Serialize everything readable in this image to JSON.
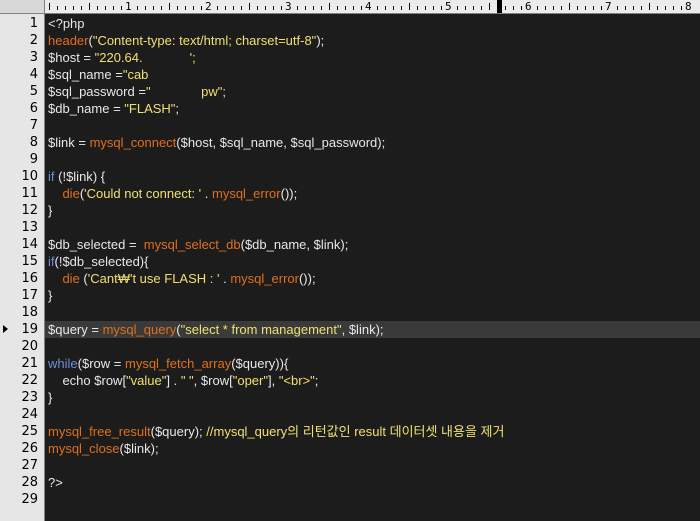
{
  "ruler": {
    "numbers": [
      "1",
      "2",
      "3",
      "4",
      "5",
      "6",
      "7",
      "8"
    ]
  },
  "current_line": 19,
  "lines": [
    [
      {
        "c": "tag",
        "t": "<?php"
      }
    ],
    [
      {
        "c": "fn",
        "t": "header"
      },
      {
        "c": "op",
        "t": "("
      },
      {
        "c": "str",
        "t": "\"Content-type: text/html; charset=utf-8\""
      },
      {
        "c": "op",
        "t": ");"
      }
    ],
    [
      {
        "c": "var",
        "t": "$host"
      },
      {
        "c": "op",
        "t": " = "
      },
      {
        "c": "str",
        "t": "\"220.64.             ';"
      }
    ],
    [
      {
        "c": "var",
        "t": "$sql_name"
      },
      {
        "c": "op",
        "t": " ="
      },
      {
        "c": "str",
        "t": "\"cab"
      }
    ],
    [
      {
        "c": "var",
        "t": "$sql_password"
      },
      {
        "c": "op",
        "t": " ="
      },
      {
        "c": "str",
        "t": "\"              pw\";"
      }
    ],
    [
      {
        "c": "var",
        "t": "$db_name"
      },
      {
        "c": "op",
        "t": " = "
      },
      {
        "c": "str",
        "t": "\"FLASH\""
      },
      {
        "c": "op",
        "t": ";"
      }
    ],
    [],
    [
      {
        "c": "var",
        "t": "$link"
      },
      {
        "c": "op",
        "t": " = "
      },
      {
        "c": "fn",
        "t": "mysql_connect"
      },
      {
        "c": "op",
        "t": "("
      },
      {
        "c": "var",
        "t": "$host"
      },
      {
        "c": "op",
        "t": ", "
      },
      {
        "c": "var",
        "t": "$sql_name"
      },
      {
        "c": "op",
        "t": ", "
      },
      {
        "c": "var",
        "t": "$sql_password"
      },
      {
        "c": "op",
        "t": ");"
      }
    ],
    [],
    [
      {
        "c": "kw",
        "t": "if"
      },
      {
        "c": "op",
        "t": " (!"
      },
      {
        "c": "var",
        "t": "$link"
      },
      {
        "c": "op",
        "t": ") {"
      }
    ],
    [
      {
        "c": "op",
        "t": "    "
      },
      {
        "c": "fn",
        "t": "die"
      },
      {
        "c": "op",
        "t": "("
      },
      {
        "c": "str",
        "t": "'Could not connect: '"
      },
      {
        "c": "op",
        "t": " . "
      },
      {
        "c": "fn",
        "t": "mysql_error"
      },
      {
        "c": "op",
        "t": "());"
      }
    ],
    [
      {
        "c": "op",
        "t": "}"
      }
    ],
    [],
    [
      {
        "c": "var",
        "t": "$db_selected"
      },
      {
        "c": "op",
        "t": " =  "
      },
      {
        "c": "fn",
        "t": "mysql_select_db"
      },
      {
        "c": "op",
        "t": "("
      },
      {
        "c": "var",
        "t": "$db_name"
      },
      {
        "c": "op",
        "t": ", "
      },
      {
        "c": "var",
        "t": "$link"
      },
      {
        "c": "op",
        "t": ");"
      }
    ],
    [
      {
        "c": "kw",
        "t": "if"
      },
      {
        "c": "op",
        "t": "(!"
      },
      {
        "c": "var",
        "t": "$db_selected"
      },
      {
        "c": "op",
        "t": "){"
      }
    ],
    [
      {
        "c": "op",
        "t": "    "
      },
      {
        "c": "fn",
        "t": "die"
      },
      {
        "c": "op",
        "t": " ("
      },
      {
        "c": "str",
        "t": "'Cant₩'t use FLASH : '"
      },
      {
        "c": "op",
        "t": " . "
      },
      {
        "c": "fn",
        "t": "mysql_error"
      },
      {
        "c": "op",
        "t": "());"
      }
    ],
    [
      {
        "c": "op",
        "t": "}"
      }
    ],
    [],
    [
      {
        "c": "var",
        "t": "$query"
      },
      {
        "c": "op",
        "t": " = "
      },
      {
        "c": "fn",
        "t": "mysql_query"
      },
      {
        "c": "op",
        "t": "("
      },
      {
        "c": "str",
        "t": "\"select * from management\""
      },
      {
        "c": "op",
        "t": ", "
      },
      {
        "c": "var",
        "t": "$link"
      },
      {
        "c": "op",
        "t": ");"
      }
    ],
    [],
    [
      {
        "c": "kw",
        "t": "while"
      },
      {
        "c": "op",
        "t": "("
      },
      {
        "c": "var",
        "t": "$row"
      },
      {
        "c": "op",
        "t": " = "
      },
      {
        "c": "fn",
        "t": "mysql_fetch_array"
      },
      {
        "c": "op",
        "t": "("
      },
      {
        "c": "var",
        "t": "$query"
      },
      {
        "c": "op",
        "t": ")){"
      }
    ],
    [
      {
        "c": "op",
        "t": "    "
      },
      {
        "c": "var",
        "t": "echo $row"
      },
      {
        "c": "op",
        "t": "["
      },
      {
        "c": "str",
        "t": "\"value\""
      },
      {
        "c": "op",
        "t": "] . "
      },
      {
        "c": "str",
        "t": "\" \""
      },
      {
        "c": "op",
        "t": ", "
      },
      {
        "c": "var",
        "t": "$row"
      },
      {
        "c": "op",
        "t": "["
      },
      {
        "c": "str",
        "t": "\"oper\""
      },
      {
        "c": "op",
        "t": "], "
      },
      {
        "c": "str",
        "t": "\"<br>\""
      },
      {
        "c": "op",
        "t": ";"
      }
    ],
    [
      {
        "c": "op",
        "t": "}"
      }
    ],
    [],
    [
      {
        "c": "fn",
        "t": "mysql_free_result"
      },
      {
        "c": "op",
        "t": "("
      },
      {
        "c": "var",
        "t": "$query"
      },
      {
        "c": "op",
        "t": "); "
      },
      {
        "c": "cm",
        "t": "//mysql_query의 리턴값인 result 데이터셋 내용을 제거"
      }
    ],
    [
      {
        "c": "fn",
        "t": "mysql_close"
      },
      {
        "c": "op",
        "t": "("
      },
      {
        "c": "var",
        "t": "$link"
      },
      {
        "c": "op",
        "t": ");"
      }
    ],
    [],
    [
      {
        "c": "tag",
        "t": "?>"
      }
    ],
    []
  ],
  "colors": {
    "background": "#1c1c1c",
    "keyword": "#6c8fd8",
    "function": "#e0701e",
    "string": "#f0e070",
    "variable": "#e8e8e8",
    "current_line": "#3a3a3a"
  }
}
